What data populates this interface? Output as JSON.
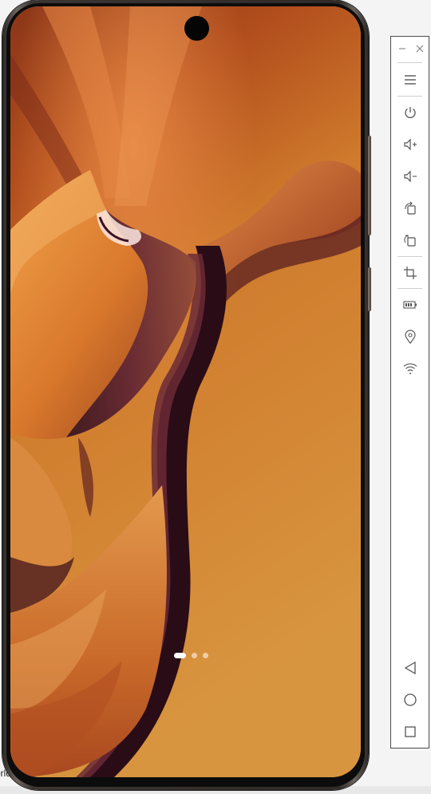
{
  "desktop": {
    "partial_text": "orld"
  },
  "phone": {
    "page_indicator": {
      "total": 3,
      "active_index": 0
    },
    "wallpaper_colors": {
      "deep": "#6e2d17",
      "mid": "#c5581e",
      "light": "#d6903e",
      "purple": "#3a1326"
    }
  },
  "toolbar": {
    "window_controls": [
      "minimize-icon",
      "close-icon"
    ],
    "buttons": [
      {
        "name": "menu",
        "icon": "hamburger-menu-icon"
      },
      {
        "name": "power",
        "icon": "power-icon"
      },
      {
        "name": "volume-up",
        "icon": "volume-up-icon"
      },
      {
        "name": "volume-down",
        "icon": "volume-down-icon"
      },
      {
        "name": "rotate-left",
        "icon": "rotate-left-icon"
      },
      {
        "name": "rotate-right",
        "icon": "rotate-right-icon"
      },
      {
        "name": "screenshot",
        "icon": "crop-icon"
      },
      {
        "name": "battery",
        "icon": "battery-icon"
      },
      {
        "name": "location",
        "icon": "location-pin-icon"
      },
      {
        "name": "wifi",
        "icon": "wifi-icon"
      },
      {
        "name": "back",
        "icon": "back-triangle-icon"
      },
      {
        "name": "home",
        "icon": "home-circle-icon"
      },
      {
        "name": "recents",
        "icon": "recents-square-icon"
      }
    ],
    "border_color": "#4a4a4a",
    "icon_color": "#555555"
  }
}
